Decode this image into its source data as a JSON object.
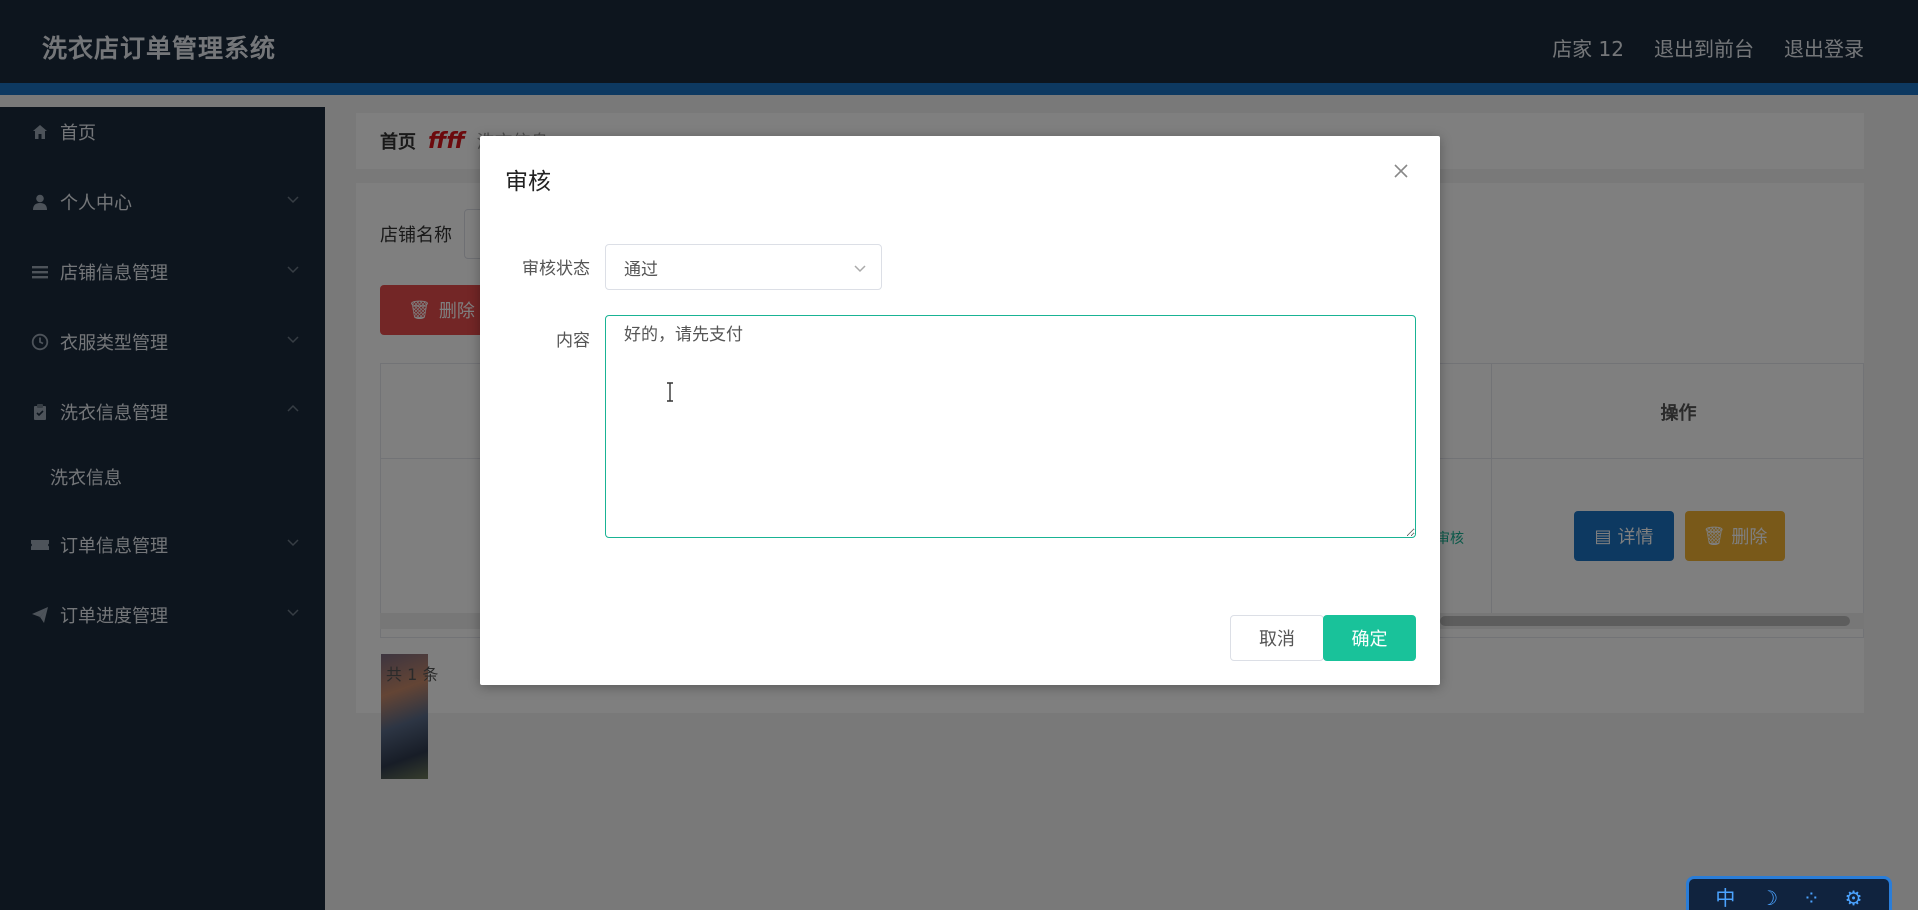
{
  "header": {
    "app_title": "洗衣店订单管理系统",
    "user": "店家 12",
    "to_front": "退出到前台",
    "logout": "退出登录"
  },
  "sidebar": {
    "items": [
      {
        "label": "首页",
        "icon": "home-icon"
      },
      {
        "label": "个人中心",
        "icon": "user-icon"
      },
      {
        "label": "店铺信息管理",
        "icon": "list-icon"
      },
      {
        "label": "衣服类型管理",
        "icon": "clock-icon"
      },
      {
        "label": "洗衣信息管理",
        "icon": "clipboard-icon"
      },
      {
        "label": "订单信息管理",
        "icon": "ticket-icon"
      },
      {
        "label": "订单进度管理",
        "icon": "paper-plane-icon"
      }
    ],
    "sub_item": "洗衣信息"
  },
  "breadcrumb": {
    "home": "首页",
    "separator": "ffff",
    "current": "洗衣信息"
  },
  "main": {
    "search_label": "店铺名称",
    "delete_label": "删除",
    "ops_header": "操作",
    "detail_label": "详情",
    "row_delete_label": "删除",
    "status_text": "审核",
    "total": "共 1 条"
  },
  "dialog": {
    "title": "审核",
    "status_label": "审核状态",
    "status_value": "通过",
    "content_label": "内容",
    "content_value": "好的，请先支付",
    "cancel_label": "取消",
    "ok_label": "确定"
  },
  "ime": {
    "mode": "中"
  },
  "colors": {
    "header_bg": "#1b2b3c",
    "accent_blue": "#1a73c2",
    "primary_green": "#19c29a",
    "danger_red": "#e74c4c",
    "warning_yellow": "#f2b233"
  }
}
